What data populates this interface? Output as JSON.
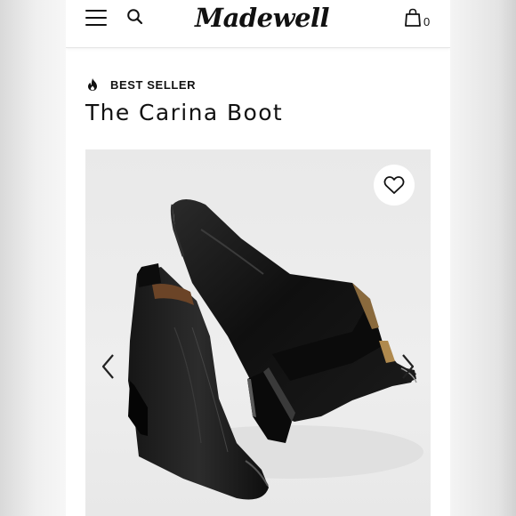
{
  "header": {
    "logo_text": "Madewell",
    "menu_icon": "hamburger-menu-icon",
    "search_icon": "search-icon",
    "bag_icon": "shopping-bag-icon",
    "bag_count": "0"
  },
  "product": {
    "badge_icon": "flame-icon",
    "badge_text": "BEST SELLER",
    "name": "The Carina Boot",
    "wishlist_icon": "heart-icon",
    "prev_icon": "chevron-left-icon",
    "next_icon": "chevron-right-icon",
    "image_alt": "Black leather ankle boots"
  },
  "colors": {
    "text": "#111111",
    "image_background": "#ebebeb",
    "boot_leather": "#141414"
  }
}
